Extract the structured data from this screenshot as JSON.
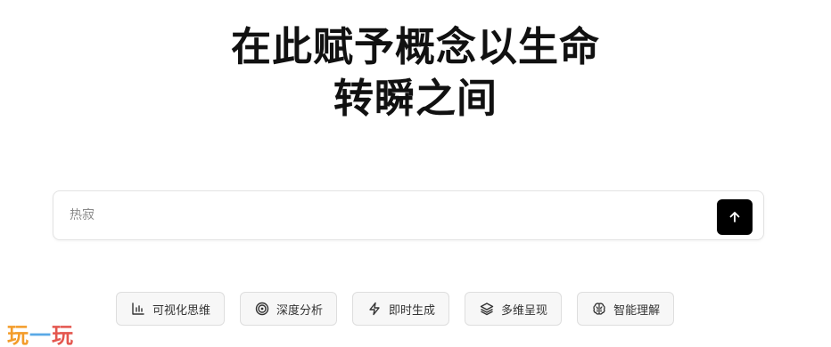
{
  "hero": {
    "line1": "在此赋予概念以生命",
    "line2": "转瞬之间"
  },
  "prompt": {
    "placeholder": "热寂",
    "send_icon": "arrow-up-icon"
  },
  "chips": [
    {
      "label": "可视化思维",
      "icon": "bar-chart-icon"
    },
    {
      "label": "深度分析",
      "icon": "target-icon"
    },
    {
      "label": "即时生成",
      "icon": "lightning-icon"
    },
    {
      "label": "多维呈现",
      "icon": "layers-icon"
    },
    {
      "label": "智能理解",
      "icon": "brain-icon"
    }
  ],
  "watermark": {
    "char1": "玩",
    "char2": "一",
    "char3": "玩"
  },
  "colors": {
    "send_button": "#000000",
    "chip_background": "#f7f7f7"
  }
}
